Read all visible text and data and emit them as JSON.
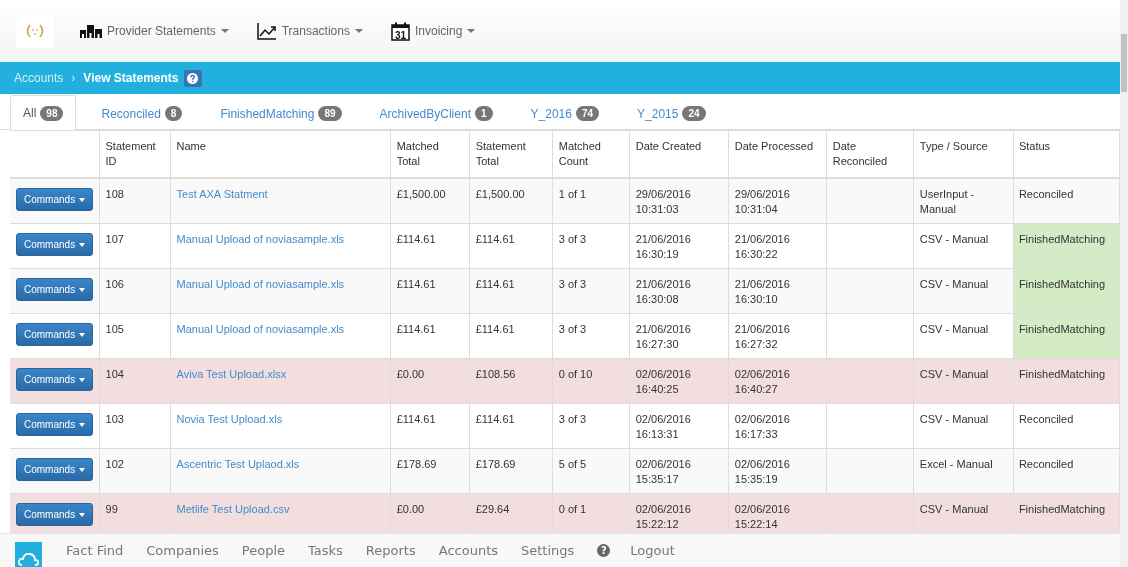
{
  "nav": {
    "items": [
      {
        "label": "Provider Statements"
      },
      {
        "label": "Transactions"
      },
      {
        "label": "Invoicing",
        "icon_text": "31"
      }
    ]
  },
  "breadcrumb": {
    "items": [
      "Accounts",
      "View Statements"
    ],
    "separator": "›"
  },
  "tabs": [
    {
      "label": "All",
      "count": "98",
      "selected": true
    },
    {
      "label": "Reconciled",
      "count": "8",
      "selected": false
    },
    {
      "label": "FinishedMatching",
      "count": "89",
      "selected": false
    },
    {
      "label": "ArchivedByClient",
      "count": "1",
      "selected": false
    },
    {
      "label": "Y_2016",
      "count": "74",
      "selected": false
    },
    {
      "label": "Y_2015",
      "count": "24",
      "selected": false
    }
  ],
  "table": {
    "columns": [
      "",
      "Statement ID",
      "Name",
      "Matched Total",
      "Statement Total",
      "Matched Count",
      "Date Created",
      "Date Processed",
      "Date Reconciled",
      "Type / Source",
      "Status"
    ],
    "rows": [
      {
        "button": "Commands",
        "id": "108",
        "name": "Test AXA Statment",
        "matched_total": "£1,500.00",
        "statement_total": "£1,500.00",
        "matched_count": "1 of 1",
        "date_created": "29/06/2016 10:31:03",
        "date_processed": "29/06/2016 10:31:04",
        "type": "UserInput - Manual",
        "status": "Reconciled",
        "danger": false,
        "status_highlight": false
      },
      {
        "button": "Commands",
        "id": "107",
        "name": "Manual Upload of noviasample.xls",
        "matched_total": "£114.61",
        "statement_total": "£114.61",
        "matched_count": "3 of 3",
        "date_created": "21/06/2016 16:30:19",
        "date_processed": "21/06/2016 16:30:22",
        "type": "CSV - Manual",
        "status": "FinishedMatching",
        "danger": false,
        "status_highlight": true
      },
      {
        "button": "Commands",
        "id": "106",
        "name": "Manual Upload of noviasample.xls",
        "matched_total": "£114.61",
        "statement_total": "£114.61",
        "matched_count": "3 of 3",
        "date_created": "21/06/2016 16:30:08",
        "date_processed": "21/06/2016 16:30:10",
        "type": "CSV - Manual",
        "status": "FinishedMatching",
        "danger": false,
        "status_highlight": true
      },
      {
        "button": "Commands",
        "id": "105",
        "name": "Manual Upload of noviasample.xls",
        "matched_total": "£114.61",
        "statement_total": "£114.61",
        "matched_count": "3 of 3",
        "date_created": "21/06/2016 16:27:30",
        "date_processed": "21/06/2016 16:27:32",
        "type": "CSV - Manual",
        "status": "FinishedMatching",
        "danger": false,
        "status_highlight": true
      },
      {
        "button": "Commands",
        "id": "104",
        "name": "Aviva Test Upload.xlsx",
        "matched_total": "£0.00",
        "statement_total": "£108.56",
        "matched_count": "0 of 10",
        "date_created": "02/06/2016 16:40:25",
        "date_processed": "02/06/2016 16:40:27",
        "type": "CSV - Manual",
        "status": "FinishedMatching",
        "danger": true,
        "status_highlight": false
      },
      {
        "button": "Commands",
        "id": "103",
        "name": "Novia Test Upload.xls",
        "matched_total": "£114.61",
        "statement_total": "£114.61",
        "matched_count": "3 of 3",
        "date_created": "02/06/2016 16:13:31",
        "date_processed": "02/06/2016 16:17:33",
        "type": "CSV - Manual",
        "status": "Reconciled",
        "danger": false,
        "status_highlight": false
      },
      {
        "button": "Commands",
        "id": "102",
        "name": "Ascentric Test Uplaod.xls",
        "matched_total": "£178.69",
        "statement_total": "£178.69",
        "matched_count": "5 of 5",
        "date_created": "02/06/2016 15:35:17",
        "date_processed": "02/06/2016 15:35:19",
        "type": "Excel - Manual",
        "status": "Reconciled",
        "danger": false,
        "status_highlight": false
      },
      {
        "button": "Commands",
        "id": "99",
        "name": "Metlife Test Upload.csv",
        "matched_total": "£0.00",
        "statement_total": "£29.64",
        "matched_count": "0 of 1",
        "date_created": "02/06/2016 15:22:12",
        "date_processed": "02/06/2016 15:22:14",
        "type": "CSV - Manual",
        "status": "FinishedMatching",
        "danger": true,
        "status_highlight": false
      }
    ]
  },
  "footer": {
    "items": [
      {
        "label": "Fact Find",
        "kind": "text"
      },
      {
        "label": "Companies",
        "kind": "text"
      },
      {
        "label": "People",
        "kind": "text"
      },
      {
        "label": "Tasks",
        "kind": "text"
      },
      {
        "label": "Reports",
        "kind": "text"
      },
      {
        "label": "Accounts",
        "kind": "text"
      },
      {
        "label": "Settings",
        "kind": "text"
      },
      {
        "label": "?",
        "kind": "help"
      },
      {
        "label": "Logout",
        "kind": "text"
      }
    ]
  }
}
